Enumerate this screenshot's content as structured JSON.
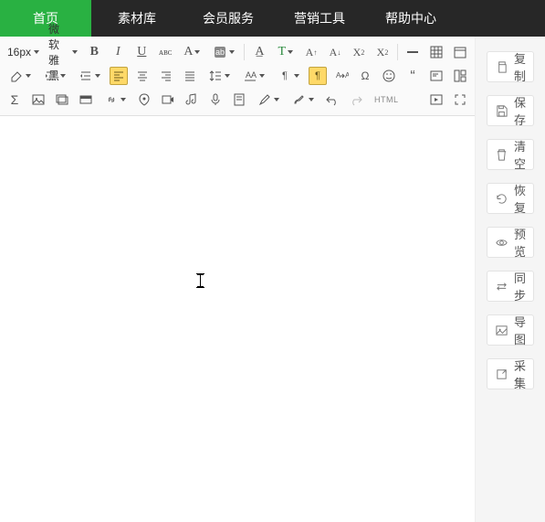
{
  "nav": {
    "items": [
      {
        "label": "首页",
        "active": true
      },
      {
        "label": "素材库",
        "active": false
      },
      {
        "label": "会员服务",
        "active": false
      },
      {
        "label": "营销工具",
        "active": false
      },
      {
        "label": "帮助中心",
        "active": false
      }
    ]
  },
  "toolbar": {
    "font_size": "16px",
    "font_family": "微软雅黑",
    "html_label": "HTML"
  },
  "sidebar": {
    "items": [
      {
        "label": "复制",
        "icon": "copy-icon"
      },
      {
        "label": "保存",
        "icon": "save-icon"
      },
      {
        "label": "清空",
        "icon": "trash-icon"
      },
      {
        "label": "恢复",
        "icon": "restore-icon"
      },
      {
        "label": "预览",
        "icon": "eye-icon"
      },
      {
        "label": "同步",
        "icon": "sync-icon"
      },
      {
        "label": "导图",
        "icon": "image-export-icon"
      },
      {
        "label": "采集",
        "icon": "collect-icon"
      }
    ]
  }
}
